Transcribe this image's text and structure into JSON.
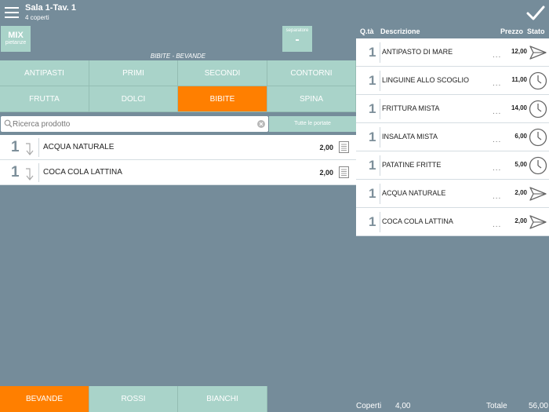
{
  "header": {
    "title": "Sala 1-Tav. 1",
    "subtitle": "4 coperti",
    "menu_icon": "hamburger-menu-icon",
    "confirm_icon": "checkmark-icon"
  },
  "mix_button": {
    "label": "MIX",
    "sublabel": "pietanze"
  },
  "separator_button": {
    "label": "separatore",
    "value": "-"
  },
  "category_title": "BIBITE - BEVANDE",
  "categories": [
    {
      "label": "ANTIPASTI",
      "active": false
    },
    {
      "label": "PRIMI",
      "active": false
    },
    {
      "label": "SECONDI",
      "active": false
    },
    {
      "label": "CONTORNI",
      "active": false
    },
    {
      "label": "FRUTTA",
      "active": false
    },
    {
      "label": "DOLCI",
      "active": false
    },
    {
      "label": "BIBITE",
      "active": true
    },
    {
      "label": "SPINA",
      "active": false
    }
  ],
  "search": {
    "placeholder": "Ricerca prodotto",
    "value": ""
  },
  "all_courses_label": "Tutte le portate",
  "products": [
    {
      "qty": "1",
      "name": "ACQUA NATURALE",
      "price": "2,00"
    },
    {
      "qty": "1",
      "name": "COCA COLA LATTINA",
      "price": "2,00"
    }
  ],
  "order_header": {
    "qty": "Q.tà",
    "desc": "Descrizione",
    "price": "Prezzo",
    "status": "Stato"
  },
  "order_items": [
    {
      "qty": "1",
      "name": "ANTIPASTO DI MARE",
      "dots": "...",
      "price": "12,00",
      "status": "sent"
    },
    {
      "qty": "1",
      "name": "LINGUINE ALLO SCOGLIO",
      "dots": "...",
      "price": "11,00",
      "status": "waiting"
    },
    {
      "qty": "1",
      "name": "FRITTURA MISTA",
      "dots": "...",
      "price": "14,00",
      "status": "waiting"
    },
    {
      "qty": "1",
      "name": "INSALATA MISTA",
      "dots": "...",
      "price": "6,00",
      "status": "waiting"
    },
    {
      "qty": "1",
      "name": "PATATINE FRITTE",
      "dots": "...",
      "price": "5,00",
      "status": "waiting"
    },
    {
      "qty": "1",
      "name": "ACQUA NATURALE",
      "dots": "...",
      "price": "2,00",
      "status": "sent"
    },
    {
      "qty": "1",
      "name": "COCA COLA LATTINA",
      "dots": "...",
      "price": "2,00",
      "status": "sent"
    }
  ],
  "bottom_tabs": [
    {
      "label": "BEVANDE",
      "active": true
    },
    {
      "label": "ROSSI",
      "active": false
    },
    {
      "label": "BIANCHI",
      "active": false
    }
  ],
  "totals": {
    "covers_label": "Coperti",
    "covers_value": "4,00",
    "total_label": "Totale",
    "total_value": "56,00"
  },
  "colors": {
    "background": "#758c9a",
    "button": "#a9d3c9",
    "accent": "#ff7f00"
  }
}
